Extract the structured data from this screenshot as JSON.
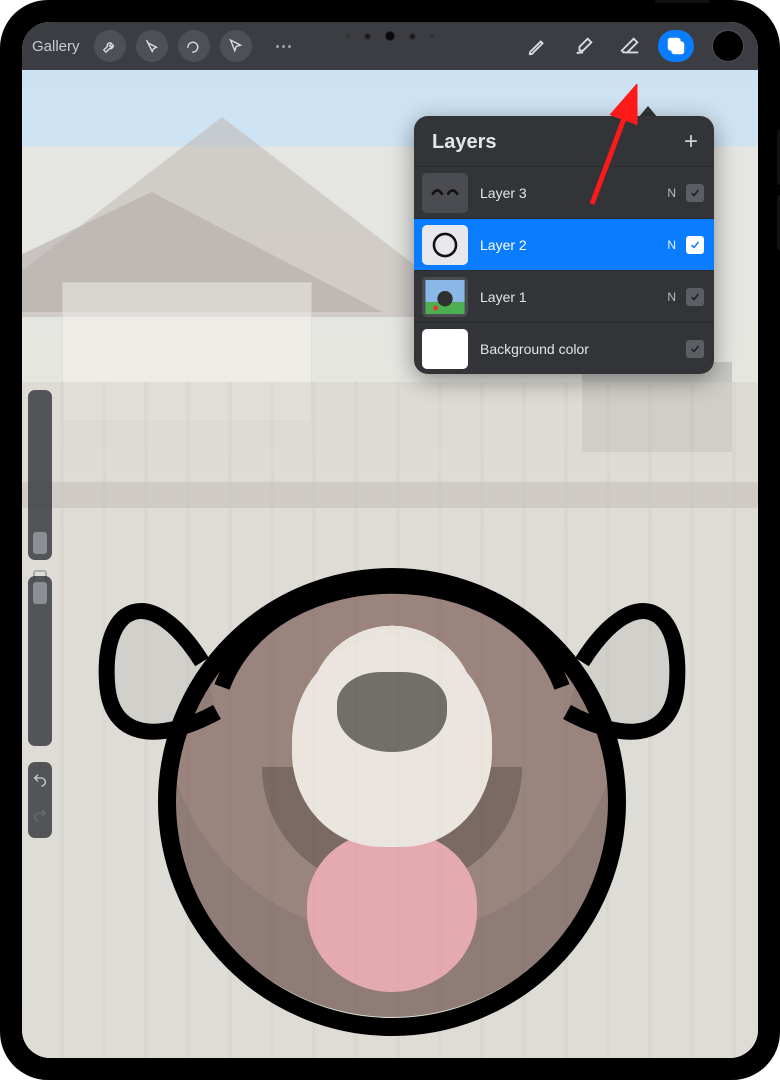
{
  "toolbar": {
    "gallery_label": "Gallery",
    "icons": {
      "wrench": "wrench-icon",
      "wand": "adjustments-icon",
      "selection": "selection-icon",
      "move": "cursor-icon",
      "brush": "brush-icon",
      "smudge": "smudge-icon",
      "eraser": "eraser-icon",
      "layers": "layers-icon",
      "color": "color-icon"
    },
    "active_tool": "layers"
  },
  "layers_panel": {
    "title": "Layers",
    "add_label": "+",
    "rows": [
      {
        "name": "Layer 3",
        "blend": "N",
        "visible": true,
        "selected": false,
        "thumb": "sketch-eyes"
      },
      {
        "name": "Layer 2",
        "blend": "N",
        "visible": true,
        "selected": true,
        "thumb": "circle-outline"
      },
      {
        "name": "Layer 1",
        "blend": "N",
        "visible": true,
        "selected": false,
        "thumb": "photo-dog"
      },
      {
        "name": "Background color",
        "blend": "",
        "visible": true,
        "selected": false,
        "thumb": "white"
      }
    ]
  },
  "annotation": {
    "target": "eraser-icon",
    "color": "#ff1a1a"
  },
  "side_controls": {
    "brush_size_slider": true,
    "opacity_slider": true,
    "undo": true,
    "redo": false
  },
  "canvas": {
    "subject": "dog-head-outline-over-photo",
    "background": "house-fence-sky-photo",
    "overlay_alpha": 0.45
  }
}
